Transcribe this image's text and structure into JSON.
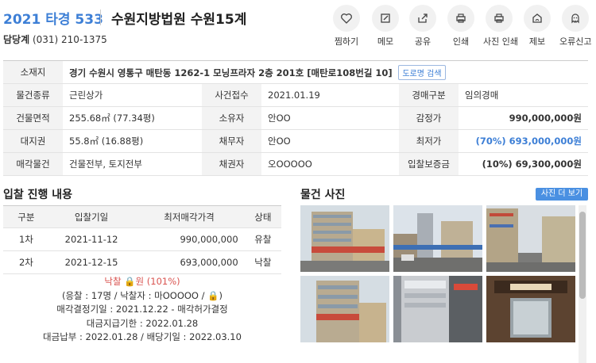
{
  "header": {
    "case_number": "2021 타경 533",
    "court": "수원지방법원 수원15계",
    "dept_label": "담당계",
    "dept_phone": "(031) 210-1375"
  },
  "actions": [
    {
      "label": "찜하기",
      "icon": "heart-icon"
    },
    {
      "label": "메모",
      "icon": "memo-icon"
    },
    {
      "label": "공유",
      "icon": "share-icon"
    },
    {
      "label": "인쇄",
      "icon": "print-icon"
    },
    {
      "label": "사진 인쇄",
      "icon": "photo-print-icon"
    },
    {
      "label": "제보",
      "icon": "report-icon"
    },
    {
      "label": "오류신고",
      "icon": "error-report-icon"
    }
  ],
  "info": {
    "location_label": "소재지",
    "location_value": "경기 수원시 영통구 매탄동 1262-1 모닝프라자 2층 201호 [매탄로108번길 10]",
    "road_search": "도로명 검색",
    "rows": [
      {
        "h1": "물건종류",
        "v1": "근린상가",
        "h2": "사건접수",
        "v2": "2021.01.19",
        "h3": "경매구분",
        "v3": "임의경매"
      },
      {
        "h1": "건물면적",
        "v1": "255.68㎡ (77.34평)",
        "h2": "소유자",
        "v2": "안OO",
        "h3": "감정가",
        "v3": "990,000,000원"
      },
      {
        "h1": "대지권",
        "v1": "55.8㎡ (16.88평)",
        "h2": "채무자",
        "v2": "안OO",
        "h3": "최저가",
        "v3": "(70%) 693,000,000원"
      },
      {
        "h1": "매각물건",
        "v1": "건물전부, 토지전부",
        "h2": "채권자",
        "v2": "오OOOOO",
        "h3": "입찰보증금",
        "v3": "(10%) 69,300,000원"
      }
    ]
  },
  "bidding": {
    "title": "입찰 진행 내용",
    "headers": [
      "구분",
      "입찰기일",
      "최저매각가격",
      "상태"
    ],
    "rows": [
      {
        "round": "1차",
        "date": "2021-11-12",
        "price": "990,000,000",
        "status": "유찰"
      },
      {
        "round": "2차",
        "date": "2021-12-15",
        "price": "693,000,000",
        "status": "낙찰"
      }
    ],
    "result_prefix": "낙찰",
    "result_mid": "원",
    "result_pct": "(101%)",
    "bidders": "(응찰 : 17명 / 낙찰자 : 마OOOOO /",
    "bidders_end": ")",
    "decision": "매각결정기일 : 2021.12.22 - 매각허가결정",
    "payment_deadline": "대금지급기한 : 2022.01.28",
    "payment": "대금납부 : 2022.01.28 / 배당기일 : 2022.03.10"
  },
  "photos": {
    "title": "물건 사진",
    "more": "사진 더 보기"
  },
  "colors": {
    "accent": "#3d7fd6",
    "sold": "#d9534f"
  }
}
